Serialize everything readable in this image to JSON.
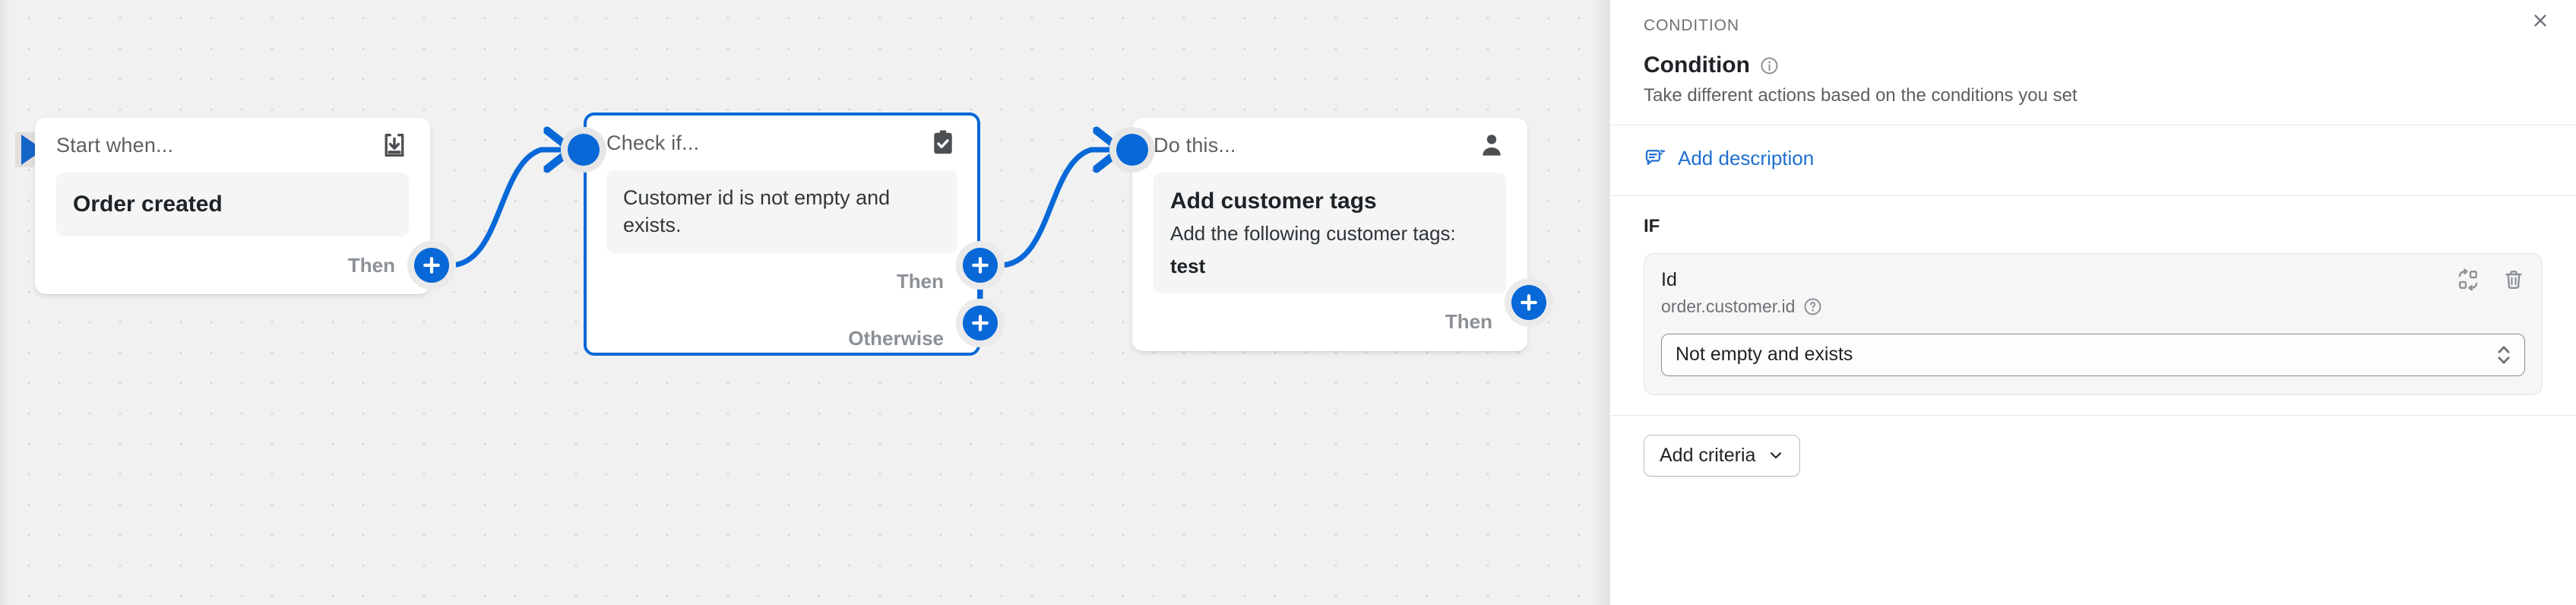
{
  "canvas": {
    "nodes": [
      {
        "title": "Start when...",
        "icon": "import-trigger-icon",
        "body_strong": "Order created",
        "foot_label": "Then"
      },
      {
        "title": "Check if...",
        "icon": "clipboard-check-icon",
        "body_plain": "Customer id is not empty and exists.",
        "foot_label": "Then",
        "foot_label_2": "Otherwise"
      },
      {
        "title": "Do this...",
        "icon": "customer-icon",
        "body_strong": "Add customer tags",
        "body_sub": "Add the following customer tags:",
        "body_tag": "test",
        "foot_label": "Then"
      }
    ],
    "start_port_name": "workflow-start-port",
    "plus_tooltip": "add-step"
  },
  "panel": {
    "eyebrow": "CONDITION",
    "title": "Condition",
    "title_info_icon": "info-circle-icon",
    "description": "Take different actions based on the conditions you set",
    "close_icon": "close-icon",
    "add_description_label": "Add description",
    "add_description_icon": "comment-edit-icon",
    "if_label": "IF",
    "criteria": {
      "field_name": "Id",
      "field_path": "order.customer.id",
      "help_icon": "question-circle-icon",
      "swap_icon": "swap-variable-icon",
      "delete_icon": "trash-icon",
      "operator_value": "Not empty and exists",
      "operator_caret_icon": "select-chevron-updown-icon"
    },
    "add_criteria_label": "Add criteria",
    "add_criteria_icon": "chevron-down-icon"
  },
  "colors": {
    "accent_blue": "#0868d8",
    "link_blue": "#1f6fd0",
    "canvas_bg": "#f1f1f1",
    "panel_bg": "#ffffff",
    "muted_text": "#8c9196"
  }
}
